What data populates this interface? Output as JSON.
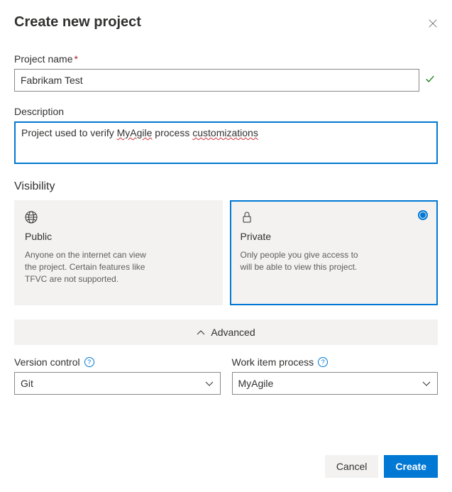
{
  "header": {
    "title": "Create new project"
  },
  "fields": {
    "projectName": {
      "label": "Project name",
      "value": "Fabrikam Test",
      "required": true,
      "valid": true
    },
    "description": {
      "label": "Description",
      "value": "Project used to verify MyAgile process customizations",
      "parts": {
        "p1": "Project used to verify ",
        "p2_misspell": "MyAgile",
        "p3": " process ",
        "p4_misspell": "customizations"
      }
    }
  },
  "visibility": {
    "label": "Visibility",
    "options": {
      "public": {
        "title": "Public",
        "description": "Anyone on the internet can view the project. Certain features like TFVC are not supported.",
        "selected": false
      },
      "private": {
        "title": "Private",
        "description": "Only people you give access to will be able to view this project.",
        "selected": true
      }
    }
  },
  "advanced": {
    "label": "Advanced",
    "versionControl": {
      "label": "Version control",
      "value": "Git"
    },
    "workItemProcess": {
      "label": "Work item process",
      "value": "MyAgile"
    }
  },
  "footer": {
    "cancel": "Cancel",
    "create": "Create"
  }
}
